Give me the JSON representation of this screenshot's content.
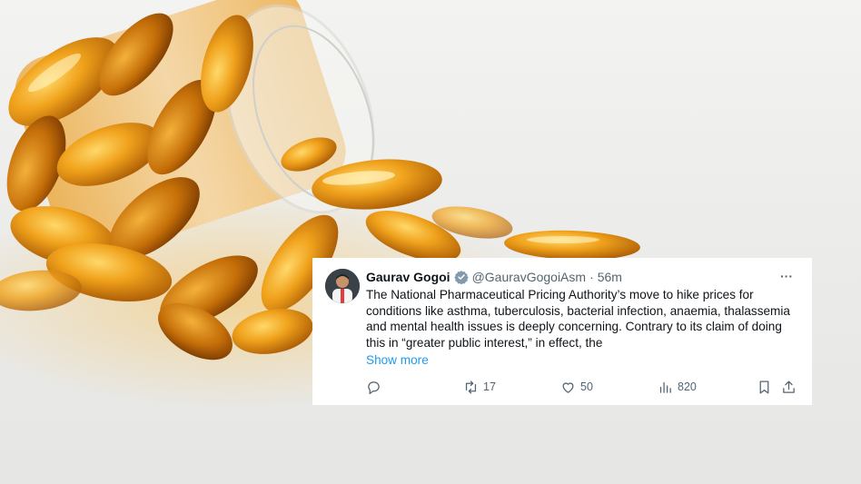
{
  "tweet": {
    "author_name": "Gaurav Gogoi",
    "handle": "@GauravGogoiAsm",
    "separator": "·",
    "time": "56m",
    "more_label": "···",
    "text": "The National Pharmaceutical Pricing Authority’s move to hike prices for conditions like asthma, tuberculosis, bacterial infection, anaemia, thalassemia and mental health issues is deeply concerning. Contrary to its claim of doing this in “greater public interest,” in effect, the",
    "show_more_label": "Show more",
    "reply_count": "",
    "retweet_count": "17",
    "like_count": "50",
    "view_count": "820",
    "icons": [
      "verified-badge-icon",
      "more-icon",
      "reply-icon",
      "retweet-icon",
      "like-icon",
      "views-icon",
      "bookmark-icon",
      "share-icon"
    ],
    "colors": {
      "link": "#1d9bf0",
      "verified": "#829aab",
      "text": "#0f1419",
      "muted": "#536471"
    }
  },
  "background": {
    "subject": "amber softgel capsules spilling from glass jar"
  }
}
